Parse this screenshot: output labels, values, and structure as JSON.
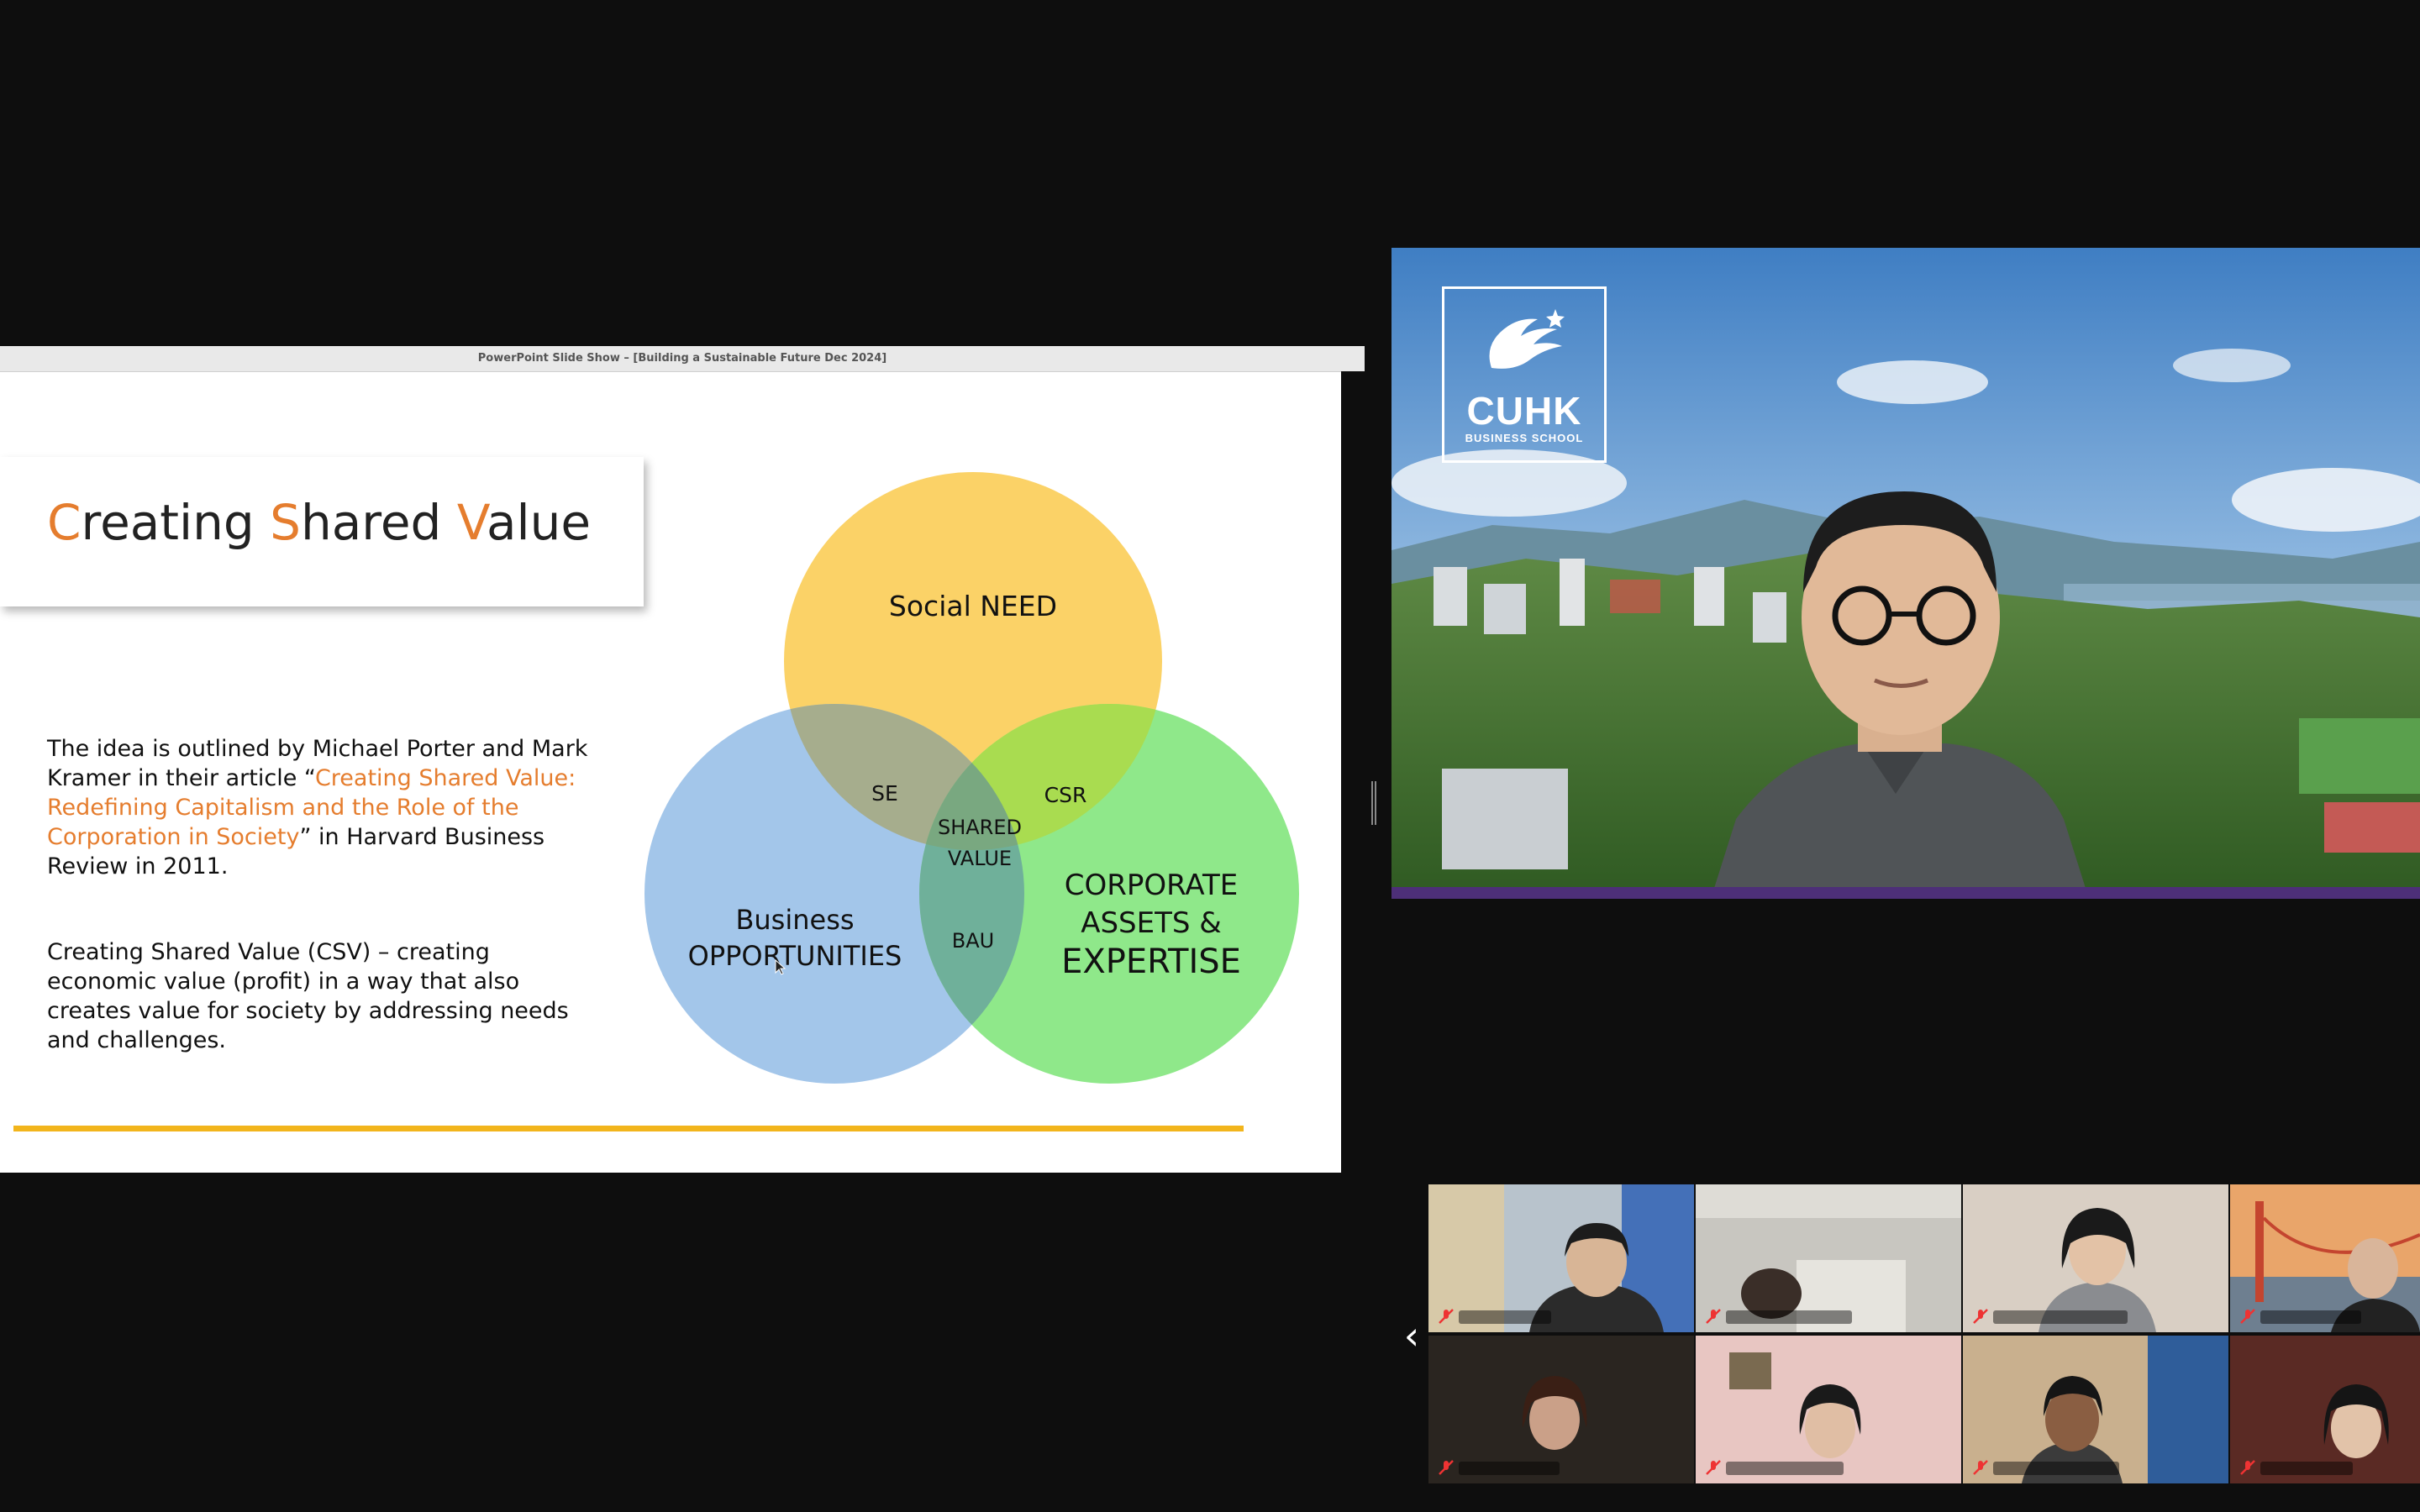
{
  "slide": {
    "window_title": "PowerPoint Slide Show – [Building a Sustainable Future Dec 2024]",
    "title": {
      "c": "C",
      "reating": "reating ",
      "s": "S",
      "hared": "hared ",
      "v": "V",
      "alue": "alue"
    },
    "paragraph1": {
      "before": "The idea is outlined by Michael Porter and Mark Kramer in their article “",
      "link": "Creating Shared Value: Redefining Capitalism and the Role of the Corporation in Society",
      "after": "” in Harvard Business Review in 2011."
    },
    "paragraph2": "Creating Shared Value (CSV) – creating economic value (profit) in a way that also creates value for society by addressing needs and challenges.",
    "venn": {
      "top": "Social NEED",
      "left_line1": "Business",
      "left_line2": "OPPORTUNITIES",
      "right_line1": "CORPORATE",
      "right_line2": "ASSETS &",
      "right_line3": "EXPERTISE",
      "overlap_top_left": "SE",
      "overlap_top_right": "CSR",
      "overlap_bottom": "BAU",
      "center_line1": "SHARED",
      "center_line2": "VALUE"
    },
    "colors": {
      "accent": "#e57d2e",
      "yellow": "#fbd267",
      "blue": "#a3c6ea",
      "green": "#8fe88a",
      "bar": "#f2b51c"
    }
  },
  "speaker": {
    "logo_name": "CUHK",
    "logo_sub": "BUSINESS SCHOOL",
    "brand_bar_color": "#4d2f78"
  },
  "gallery": {
    "participant_count": 8,
    "prev_icon": "chevron-left-icon",
    "mute_icon": "muted-mic-icon"
  }
}
